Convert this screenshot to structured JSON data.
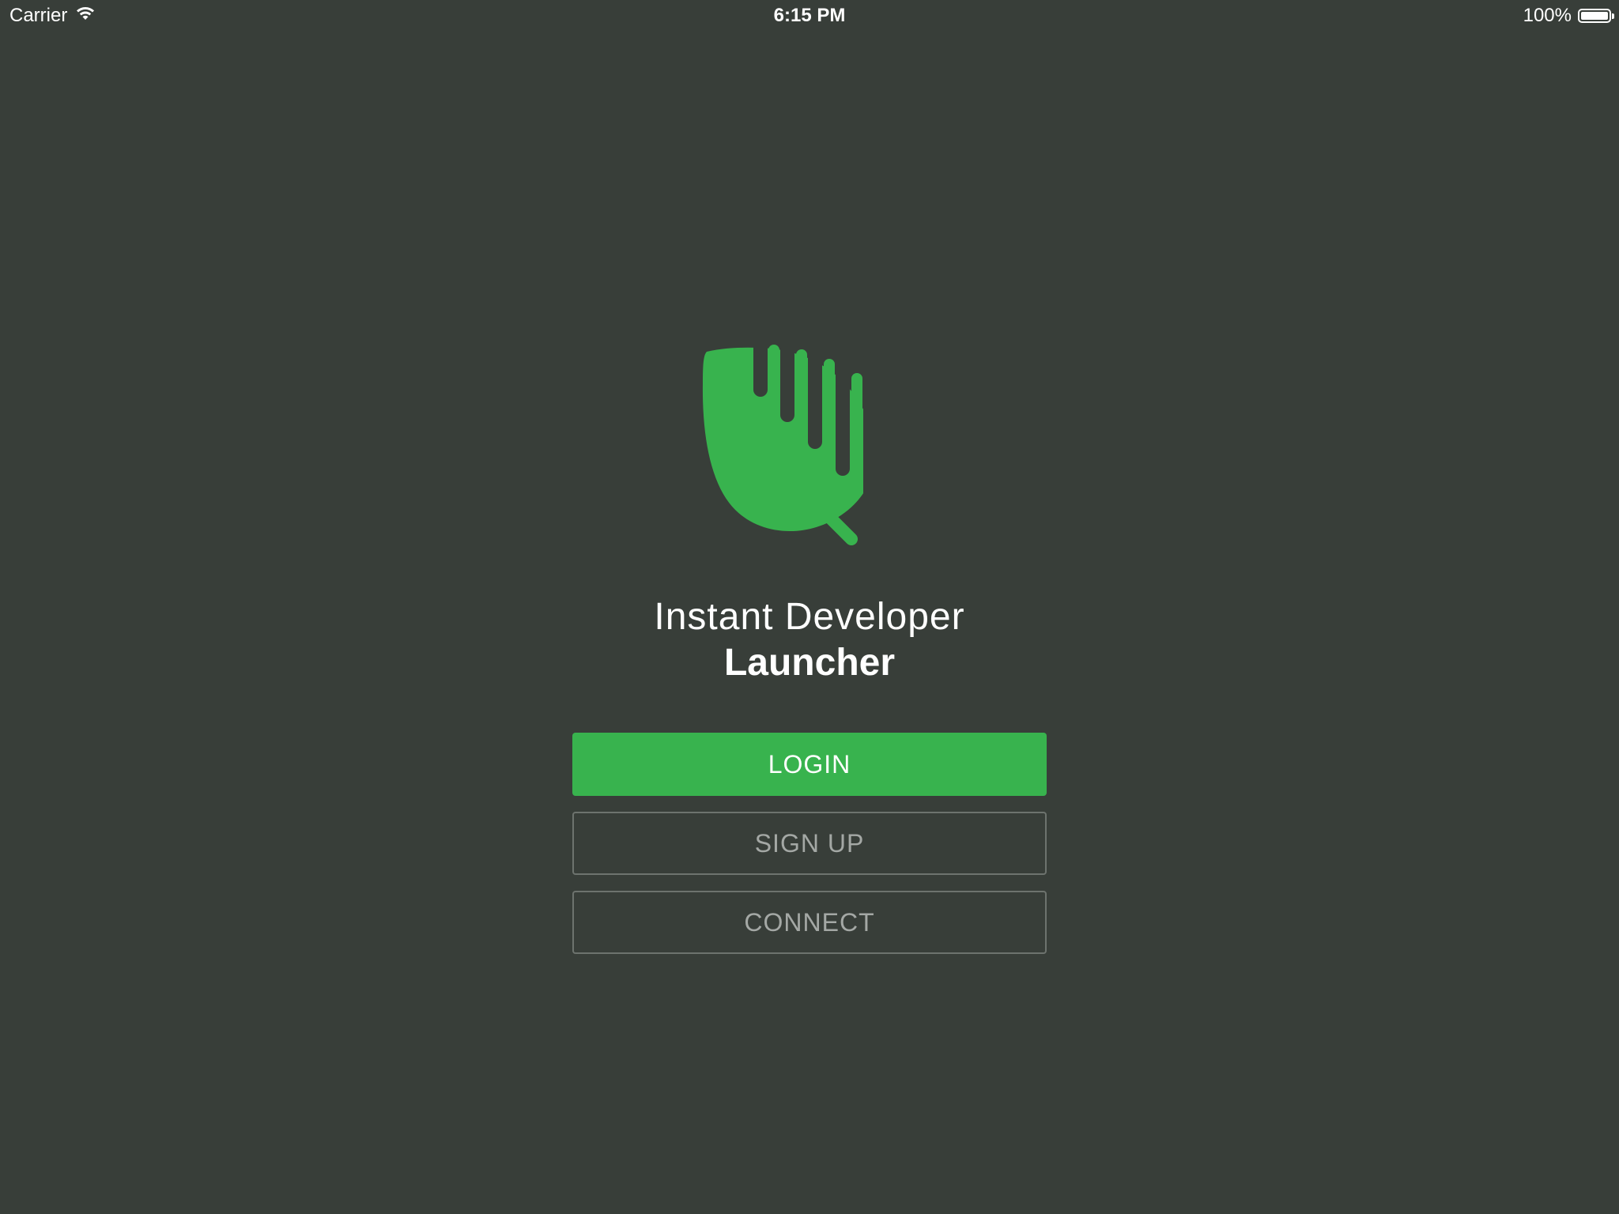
{
  "status_bar": {
    "carrier": "Carrier",
    "time": "6:15 PM",
    "battery_percent": "100%",
    "battery_level": 1.0,
    "wifi_icon": "wifi-icon",
    "battery_icon": "battery-icon"
  },
  "logo": {
    "icon": "leaf-logo-icon",
    "color": "#38b34e"
  },
  "title": {
    "line1": "Instant Developer",
    "line2": "Launcher"
  },
  "buttons": {
    "login": "LOGIN",
    "signup": "SIGN UP",
    "connect": "CONNECT"
  },
  "colors": {
    "background": "#383e39",
    "accent": "#38b34e",
    "outline": "#6d736e",
    "muted_text": "#a4a8a5"
  }
}
